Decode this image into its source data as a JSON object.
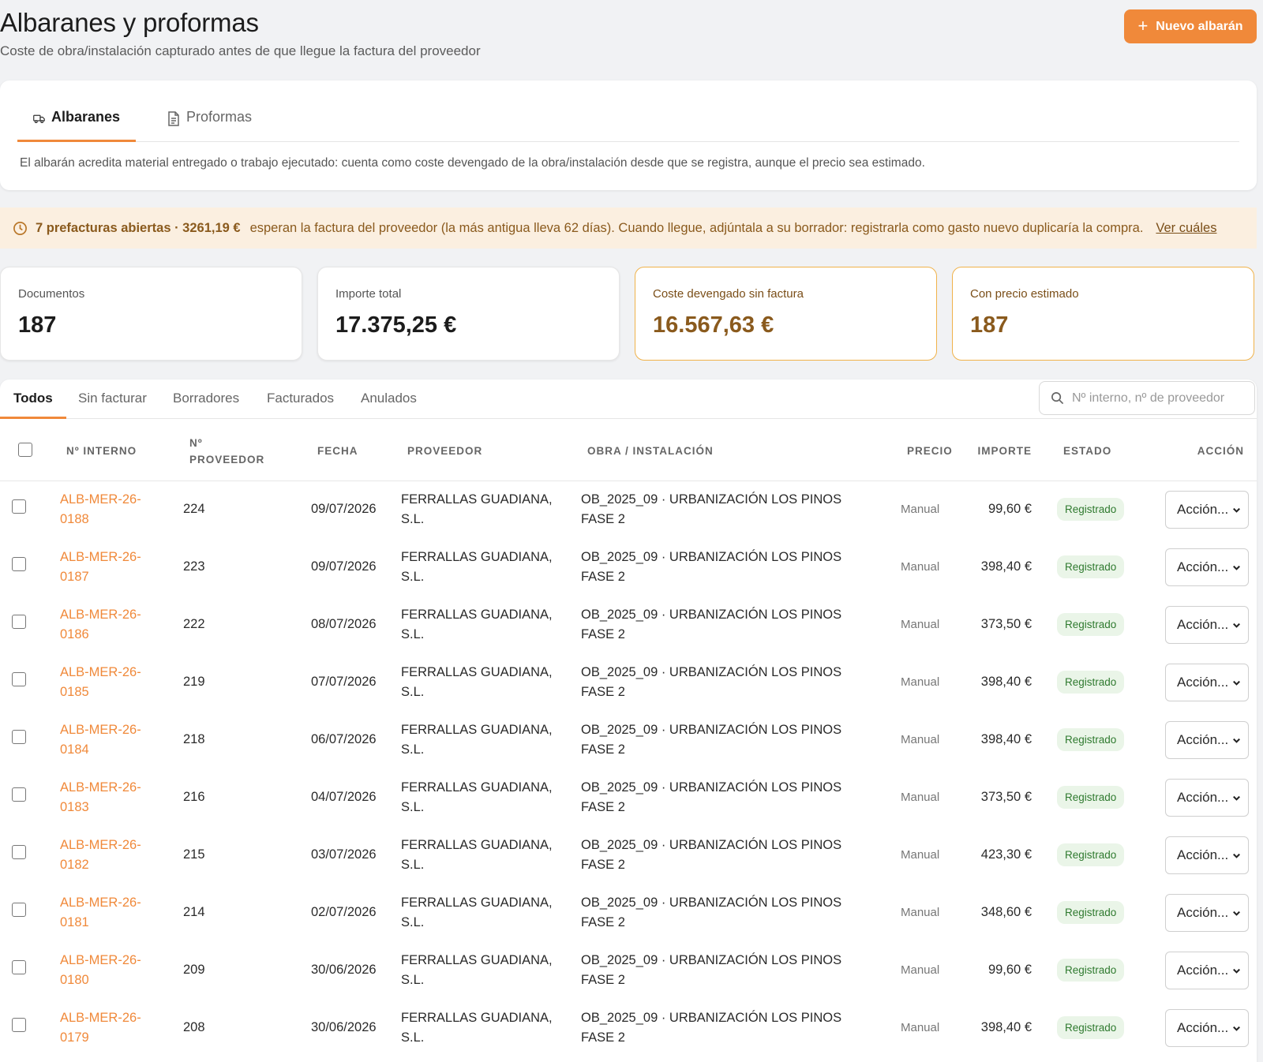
{
  "header": {
    "title": "Albaranes y proformas",
    "subtitle": "Coste de obra/instalación capturado antes de que llegue la factura del proveedor",
    "new_button_label": "Nuevo albarán"
  },
  "doc_tabs": [
    {
      "label": "Albaranes",
      "icon": "truck-icon",
      "active": true
    },
    {
      "label": "Proformas",
      "icon": "document-icon",
      "active": false
    }
  ],
  "tab_note": "El albarán acredita material entregado o trabajo ejecutado: cuenta como coste devengado de la obra/instalación desde que se registra, aunque el precio sea estimado.",
  "alert": {
    "icon": "clock-icon",
    "strong": "7 prefacturas abiertas · 3261,19 €",
    "message": "esperan la factura del proveedor (la más antigua lleva 62 días). Cuando llegue, adjúntala a su borrador: registrarla como gasto nuevo duplicaría la compra.",
    "link": "Ver cuáles"
  },
  "stats": [
    {
      "label": "Documentos",
      "value": "187",
      "highlight": false
    },
    {
      "label": "Importe total",
      "value": "17.375,25 €",
      "highlight": false
    },
    {
      "label": "Coste devengado sin factura",
      "value": "16.567,63 €",
      "highlight": true
    },
    {
      "label": "Con precio estimado",
      "value": "187",
      "highlight": true
    }
  ],
  "filter_tabs": [
    "Todos",
    "Sin facturar",
    "Borradores",
    "Facturados",
    "Anulados"
  ],
  "search": {
    "placeholder": "Nº interno, nº de proveedor"
  },
  "columns": {
    "internal": "Nº INTERNO",
    "supplier_no_1": "Nº",
    "supplier_no_2": "PROVEEDOR",
    "date": "FECHA",
    "supplier": "PROVEEDOR",
    "project": "OBRA / INSTALACIÓN",
    "price": "PRECIO",
    "amount": "IMPORTE",
    "status": "ESTADO",
    "action": "ACCIÓN"
  },
  "rows": [
    {
      "ref1": "ALB-MER-26-",
      "ref2": "0188",
      "no": "224",
      "date": "09/07/2026",
      "sup1": "FERRALLAS GUADIANA,",
      "sup2": "S.L.",
      "proj1": "OB_2025_09 · URBANIZACIÓN LOS PINOS",
      "proj2": "FASE 2",
      "price": "Manual",
      "amount": "99,60 €",
      "status": "Registrado",
      "action": "Acción..."
    },
    {
      "ref1": "ALB-MER-26-",
      "ref2": "0187",
      "no": "223",
      "date": "09/07/2026",
      "sup1": "FERRALLAS GUADIANA,",
      "sup2": "S.L.",
      "proj1": "OB_2025_09 · URBANIZACIÓN LOS PINOS",
      "proj2": "FASE 2",
      "price": "Manual",
      "amount": "398,40 €",
      "status": "Registrado",
      "action": "Acción..."
    },
    {
      "ref1": "ALB-MER-26-",
      "ref2": "0186",
      "no": "222",
      "date": "08/07/2026",
      "sup1": "FERRALLAS GUADIANA,",
      "sup2": "S.L.",
      "proj1": "OB_2025_09 · URBANIZACIÓN LOS PINOS",
      "proj2": "FASE 2",
      "price": "Manual",
      "amount": "373,50 €",
      "status": "Registrado",
      "action": "Acción..."
    },
    {
      "ref1": "ALB-MER-26-",
      "ref2": "0185",
      "no": "219",
      "date": "07/07/2026",
      "sup1": "FERRALLAS GUADIANA,",
      "sup2": "S.L.",
      "proj1": "OB_2025_09 · URBANIZACIÓN LOS PINOS",
      "proj2": "FASE 2",
      "price": "Manual",
      "amount": "398,40 €",
      "status": "Registrado",
      "action": "Acción..."
    },
    {
      "ref1": "ALB-MER-26-",
      "ref2": "0184",
      "no": "218",
      "date": "06/07/2026",
      "sup1": "FERRALLAS GUADIANA,",
      "sup2": "S.L.",
      "proj1": "OB_2025_09 · URBANIZACIÓN LOS PINOS",
      "proj2": "FASE 2",
      "price": "Manual",
      "amount": "398,40 €",
      "status": "Registrado",
      "action": "Acción..."
    },
    {
      "ref1": "ALB-MER-26-",
      "ref2": "0183",
      "no": "216",
      "date": "04/07/2026",
      "sup1": "FERRALLAS GUADIANA,",
      "sup2": "S.L.",
      "proj1": "OB_2025_09 · URBANIZACIÓN LOS PINOS",
      "proj2": "FASE 2",
      "price": "Manual",
      "amount": "373,50 €",
      "status": "Registrado",
      "action": "Acción..."
    },
    {
      "ref1": "ALB-MER-26-",
      "ref2": "0182",
      "no": "215",
      "date": "03/07/2026",
      "sup1": "FERRALLAS GUADIANA,",
      "sup2": "S.L.",
      "proj1": "OB_2025_09 · URBANIZACIÓN LOS PINOS",
      "proj2": "FASE 2",
      "price": "Manual",
      "amount": "423,30 €",
      "status": "Registrado",
      "action": "Acción..."
    },
    {
      "ref1": "ALB-MER-26-",
      "ref2": "0181",
      "no": "214",
      "date": "02/07/2026",
      "sup1": "FERRALLAS GUADIANA,",
      "sup2": "S.L.",
      "proj1": "OB_2025_09 · URBANIZACIÓN LOS PINOS",
      "proj2": "FASE 2",
      "price": "Manual",
      "amount": "348,60 €",
      "status": "Registrado",
      "action": "Acción..."
    },
    {
      "ref1": "ALB-MER-26-",
      "ref2": "0180",
      "no": "209",
      "date": "30/06/2026",
      "sup1": "FERRALLAS GUADIANA,",
      "sup2": "S.L.",
      "proj1": "OB_2025_09 · URBANIZACIÓN LOS PINOS",
      "proj2": "FASE 2",
      "price": "Manual",
      "amount": "99,60 €",
      "status": "Registrado",
      "action": "Acción..."
    },
    {
      "ref1": "ALB-MER-26-",
      "ref2": "0179",
      "no": "208",
      "date": "30/06/2026",
      "sup1": "FERRALLAS GUADIANA,",
      "sup2": "S.L.",
      "proj1": "OB_2025_09 · URBANIZACIÓN LOS PINOS",
      "proj2": "FASE 2",
      "price": "Manual",
      "amount": "398,40 €",
      "status": "Registrado",
      "action": "Acción..."
    }
  ]
}
